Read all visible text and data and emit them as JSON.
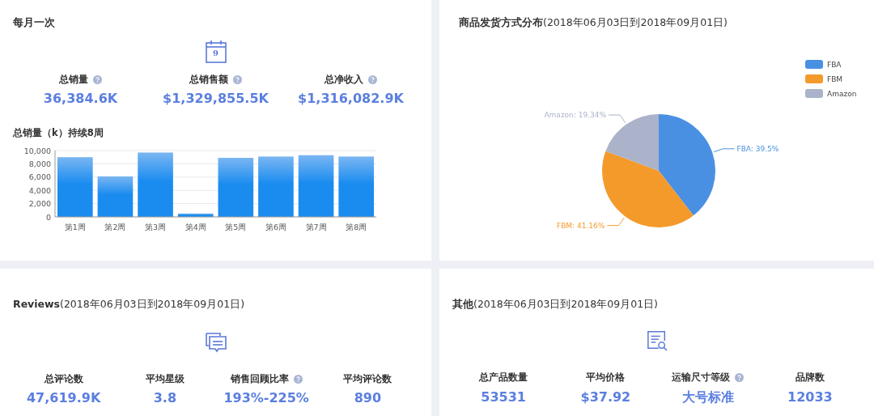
{
  "panels": [
    {
      "kind": "monthly",
      "title": "每月一次",
      "calendar_day": "9",
      "stats": [
        {
          "label": "总销量",
          "help": true,
          "value": "36,384.6K"
        },
        {
          "label": "总销售额",
          "help": true,
          "value": "$1,329,855.5K"
        },
        {
          "label": "总净收入",
          "help": true,
          "value": "$1,316,082.9K"
        }
      ],
      "chart_title": "总销量（k）持续8周",
      "chart_data": {
        "type": "bar",
        "categories": [
          "第1周",
          "第2周",
          "第3周",
          "第4周",
          "第5周",
          "第6周",
          "第7周",
          "第8周"
        ],
        "series": [
          {
            "color": "#1a8cf0",
            "values": [
              9000,
              6100,
              9700,
              500,
              8900,
              9100,
              9300,
              9100
            ]
          }
        ],
        "ylim": [
          0,
          10000
        ],
        "grid": true,
        "yticks": [
          {
            "value": 0,
            "label": "0"
          },
          {
            "value": 2000,
            "label": "2,000"
          },
          {
            "value": 4000,
            "label": "4,000"
          },
          {
            "value": 6000,
            "label": "6,000"
          },
          {
            "value": 8000,
            "label": "8,000"
          },
          {
            "value": 10000,
            "label": "10,000"
          }
        ]
      }
    },
    {
      "kind": "pie",
      "title": "**商品发货方式分布**(2018年06月03日到2018年09月01日)",
      "chart_data": {
        "type": "pie",
        "categories": [
          "FBA",
          "FBM",
          "Amazon"
        ],
        "values": [
          39.5,
          41.16,
          19.34
        ],
        "colors": [
          "#4a90e2",
          "#f39a2b",
          "#aab3c9"
        ],
        "legend": true,
        "value_labels": [
          "FBA: 39.5%",
          "FBM: 41.16%",
          "Amazon: 19.34%"
        ]
      }
    },
    {
      "kind": "reviews",
      "title": "**Reviews**(2018年06月03日到2018年09月01日)",
      "stats": [
        {
          "label": "总评论数",
          "help": false,
          "value": "47,619.9K"
        },
        {
          "label": "平均星级",
          "help": false,
          "value": "3.8"
        },
        {
          "label": "销售回顾比率",
          "help": true,
          "value": "193%-225%"
        },
        {
          "label": "平均评论数",
          "help": false,
          "value": "890"
        }
      ]
    },
    {
      "kind": "other",
      "title": "**其他**(2018年06月03日到2018年09月01日)",
      "stats": [
        {
          "label": "总产品数量",
          "help": false,
          "value": "53531"
        },
        {
          "label": "平均价格",
          "help": false,
          "value": "$37.92"
        },
        {
          "label": "运输尺寸等级",
          "help": true,
          "value": "大号标准"
        },
        {
          "label": "品牌数",
          "help": false,
          "value": "12033"
        }
      ]
    }
  ]
}
